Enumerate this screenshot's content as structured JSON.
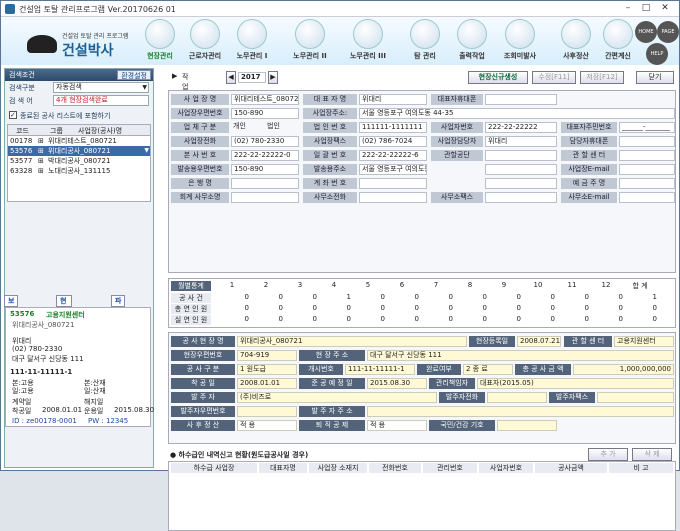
{
  "window": {
    "title": "건설업 토탈 관리프로그램  Ver.20170626 01"
  },
  "logo": {
    "sub": "건설업 토탈 관리 프로그램",
    "main": "건설박사"
  },
  "menu": [
    "현장관리",
    "근로자관리",
    "노무관리 I",
    "노무관리 II",
    "노무관리 III",
    "탐 관리",
    "출력작업",
    "조회미발사",
    "사후정산",
    "간편계신"
  ],
  "round_buttons": [
    "HOME",
    "PAGE",
    "HELP"
  ],
  "left": {
    "search_title": "검색조건",
    "env_btn": "환경설정",
    "kind_label": "검색구분",
    "kind_value": "자동검색",
    "word_label": "검 색 어",
    "word_value": "4개 현장검색완료",
    "check_label": "종료된 공사 리스트에 포함하기",
    "cols": [
      "코드",
      "그룹",
      "사업장(공사)명"
    ],
    "rows": [
      {
        "code": "00178",
        "name": "위대리테스트_080721"
      },
      {
        "code": "53576",
        "name": "위대리공사_080721"
      },
      {
        "code": "53577",
        "name": "박대리공사_080721"
      },
      {
        "code": "63328",
        "name": "노대리공사_131115"
      }
    ],
    "tabs": [
      "보험료확인",
      "현장ID생성",
      "파일전송"
    ],
    "card": {
      "code": "53576",
      "title": "고용지원센터",
      "name": "위대리공사_080721",
      "mgr": "위대리",
      "tel": "(02) 780-2330",
      "addr": "대구 달서구 신당동 111",
      "num": "111-11-11111-1",
      "k1": "본:고용",
      "k2": "본:산재",
      "k3": "일:고용",
      "k4": "일:산재",
      "cl": "계약일",
      "cl_v": "",
      "cc": "해지일",
      "cc_v": "",
      "st": "착공일",
      "st_v": "2008.01.01",
      "op": "운용일",
      "op_v": "2015.08.30",
      "id": "ID : ze00178-0001",
      "pw": "PW : 12345"
    }
  },
  "toolbar": {
    "year_label": "작업년도",
    "year": "2017",
    "btn_new": "현장신규생성",
    "btn_edit": "수정[F11]",
    "btn_save": "저장[F12]",
    "btn_close": "닫기"
  },
  "form": {
    "r1": [
      "사 업 장 명",
      "위대리테스트_080721",
      "대 표 자 명",
      "위대리",
      "대표자휴대폰",
      ""
    ],
    "r2": [
      "사업장우편번호",
      "150-890",
      "사업장주소:",
      "서울 영등포구 여의도동 44-35"
    ],
    "r3": [
      "업 체 구 분",
      "개인",
      "법인",
      "법 인 번 호",
      "111111-1111111",
      "사업자번호",
      "222-22-22222",
      "대표자주민번호",
      "______-_______"
    ],
    "r4": [
      "사업장전화",
      "(02) 780-2330",
      "사업장팩스",
      "(02) 786-7024",
      "사업장담당자",
      "위대리",
      "담당자휴대폰",
      ""
    ],
    "r5": [
      "본 사 번 호",
      "222-22-22222-0",
      "일 괄 번 호",
      "222-22-22222-6",
      "관할공단",
      "",
      "관 할 센 터",
      ""
    ],
    "r6": [
      "발송용우편번호",
      "150-890",
      "발송용주소",
      "서울 영등포구 여의도동 44-35",
      "",
      "",
      "사업장E-mail",
      ""
    ],
    "r7": [
      "은 행 명",
      "",
      "계 좌 번 호",
      "",
      "",
      "",
      "예 금 주 명",
      ""
    ],
    "r8": [
      "회계 사무소명",
      "",
      "사무소전화",
      "",
      "사무소팩스",
      "",
      "사무소E-mail",
      ""
    ]
  },
  "stats": {
    "head": "월별통계",
    "months": [
      "1",
      "2",
      "3",
      "4",
      "5",
      "6",
      "7",
      "8",
      "9",
      "10",
      "11",
      "12",
      "합 계"
    ],
    "rows": [
      {
        "label": "공 사 건",
        "vals": [
          "0",
          "0",
          "0",
          "1",
          "0",
          "0",
          "0",
          "0",
          "0",
          "0",
          "0",
          "0",
          "1"
        ]
      },
      {
        "label": "총 연 인 원",
        "vals": [
          "0",
          "0",
          "0",
          "0",
          "0",
          "0",
          "0",
          "0",
          "0",
          "0",
          "0",
          "0",
          "0"
        ]
      },
      {
        "label": "실 연 인 원",
        "vals": [
          "0",
          "0",
          "0",
          "0",
          "0",
          "0",
          "0",
          "0",
          "0",
          "0",
          "0",
          "0",
          "0"
        ]
      }
    ]
  },
  "project": {
    "name_l": "공 사 현 장 명",
    "name_v": "위대리공사_080721",
    "reg_l": "현장등록일",
    "reg_v": "2008.07.21",
    "center_l": "관 할 센 터",
    "center_v": "고용지원센터",
    "zip_l": "현장우편번호",
    "zip_v": "704-919",
    "addr_l": "현 장 주 소",
    "addr_v": "대구 달서구 신당동 111",
    "kind_l": "공 사 구 분",
    "kind_v": "1 원도급",
    "open_l": "개시번호",
    "open_v": "111-11-11111-1",
    "end_l": "완료여부",
    "end_v": "2 종 료",
    "amt_l": "총 공 사 금 액",
    "amt_v": "1,000,000,000",
    "start_l": "착 공 일",
    "start_v": "2008.01.01",
    "plan_l": "준 공 예 정 일",
    "plan_v": "2015.08.30",
    "gm_l": "관리책임자",
    "gm_v": "대표자(2015.05)",
    "order_l": "발 주 자",
    "order_v": "(주)비즈로",
    "otel_l": "발주자전화",
    "ofax_l": "발주자팩스",
    "ozip_l": "발주자우편번호",
    "oaddr_l": "발 주 자 주 소",
    "post_l": "사 후 정 산",
    "post_v": "적 용",
    "ret_l": "퇴 직 공 제",
    "ret_v": "적 용",
    "pen_l": "국민/건강 기호"
  },
  "sub": {
    "title": "하수급인 내역신고 현황(원도급공사일 경우)",
    "add": "추 가",
    "del": "삭 제",
    "cols": [
      "하수급 사업장",
      "대표자명",
      "사업장 소재지",
      "전화번호",
      "관리번호",
      "사업자번호",
      "공사금액",
      "비 고"
    ]
  }
}
